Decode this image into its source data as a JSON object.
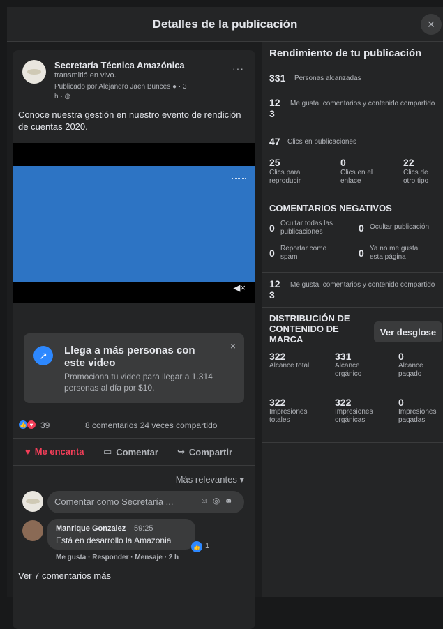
{
  "modal": {
    "title": "Detalles de la publicación",
    "close": "×"
  },
  "post": {
    "page_name": "Secretaría Técnica Amazónica",
    "action_text": "transmitió en vivo.",
    "published_by": "Publicado por Alejandro Jaen Bunces",
    "published_time_a": "· 3",
    "published_time_b": "h ·",
    "menu": "···",
    "text": "Conoce nuestra gestión en nuestro evento de rendición de cuentas 2020."
  },
  "promo": {
    "title": "Llega a más personas con este video",
    "description": "Promociona tu video para llegar a 1.314 personas al día por $10.",
    "close": "×"
  },
  "reactions": {
    "count": "39",
    "stats": "8 comentarios  24 veces compartido"
  },
  "actions": {
    "love": "Me encanta",
    "comment": "Comentar",
    "share": "Compartir"
  },
  "sort": {
    "label": "Más relevantes ▾"
  },
  "comment_input": {
    "placeholder": "Comentar como Secretaría ..."
  },
  "comment": {
    "author": "Manrique Gonzalez",
    "time": "59:25",
    "text": "Está en desarrollo la Amazonia",
    "likes": "1",
    "actions": "Me gusta · Responder · Mensaje · 2 h"
  },
  "more_comments": "Ver 7 comentarios más",
  "performance": {
    "title": "Rendimiento de tu publicación",
    "reached_value": "331",
    "reached_label": "Personas alcanzadas",
    "engagement_value_a": "12",
    "engagement_value_b": "3",
    "engagement_label": "Me gusta, comentarios y contenido compartido",
    "clicks_value": "47",
    "clicks_label": "Clics en publicaciones",
    "click_breakdown": [
      {
        "value": "25",
        "label": "Clics para reproducir"
      },
      {
        "value": "0",
        "label": "Clics en el enlace"
      },
      {
        "value": "22",
        "label": "Clics de otro tipo"
      }
    ],
    "negative_title": "COMENTARIOS NEGATIVOS",
    "negative": [
      {
        "value": "0",
        "label": "Ocultar todas las publicaciones"
      },
      {
        "value": "0",
        "label": "Ocultar publicación"
      },
      {
        "value": "0",
        "label": "Reportar como spam"
      },
      {
        "value": "0",
        "label": "Ya no me gusta esta página"
      }
    ],
    "engagement2_value_a": "12",
    "engagement2_value_b": "3",
    "engagement2_label": "Me gusta, comentarios y contenido compartido",
    "brand_title": "DISTRIBUCIÓN DE CONTENIDO DE MARCA",
    "brand_button": "Ver desglose",
    "reach_stats": [
      {
        "value": "322",
        "label": "Alcance total"
      },
      {
        "value": "331",
        "label": "Alcance orgánico"
      },
      {
        "value": "0",
        "label": "Alcance pagado"
      }
    ],
    "impression_stats": [
      {
        "value": "322",
        "label": "Impresiones totales"
      },
      {
        "value": "322",
        "label": "Impresiones orgánicas"
      },
      {
        "value": "0",
        "label": "Impresiones pagadas"
      }
    ]
  }
}
